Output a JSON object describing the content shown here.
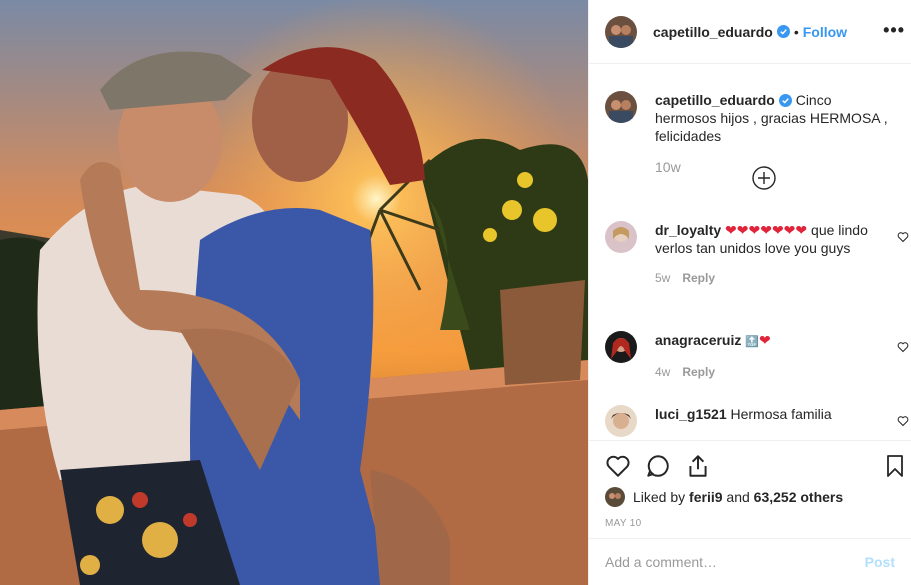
{
  "post": {
    "author": "capetillo_eduardo",
    "follow_label": "Follow",
    "separator": "•",
    "more_label": "•••",
    "caption": "Cinco hermosos hijos , gracias HERMOSA , felicidades",
    "caption_time": "10w",
    "photo_alt": "Couple embracing at sunset"
  },
  "comments": [
    {
      "user": "dr_loyalty",
      "text": "❤️❤️❤️❤️❤️❤️❤️ que lindo verlos tan unidos love you guys",
      "hearts": "❤❤❤❤❤❤❤",
      "body": "que lindo verlos tan unidos love you guys",
      "time": "5w",
      "reply": "Reply"
    },
    {
      "user": "anagraceruiz",
      "emoji": "🔝",
      "heart": "❤",
      "time": "4w",
      "reply": "Reply"
    },
    {
      "user": "luci_g1521",
      "text": "Hermosa familia"
    }
  ],
  "likes": {
    "prefix": "Liked by",
    "user": "ferii9",
    "and": "and",
    "others": "63,252 others"
  },
  "date": "MAY 10",
  "add_comment": {
    "placeholder": "Add a comment…",
    "post_label": "Post"
  },
  "colors": {
    "accent": "#3897f0",
    "verified": "#3897f0",
    "heart": "#e0243a",
    "muted": "#999999",
    "post_disabled": "#b2dffc"
  }
}
